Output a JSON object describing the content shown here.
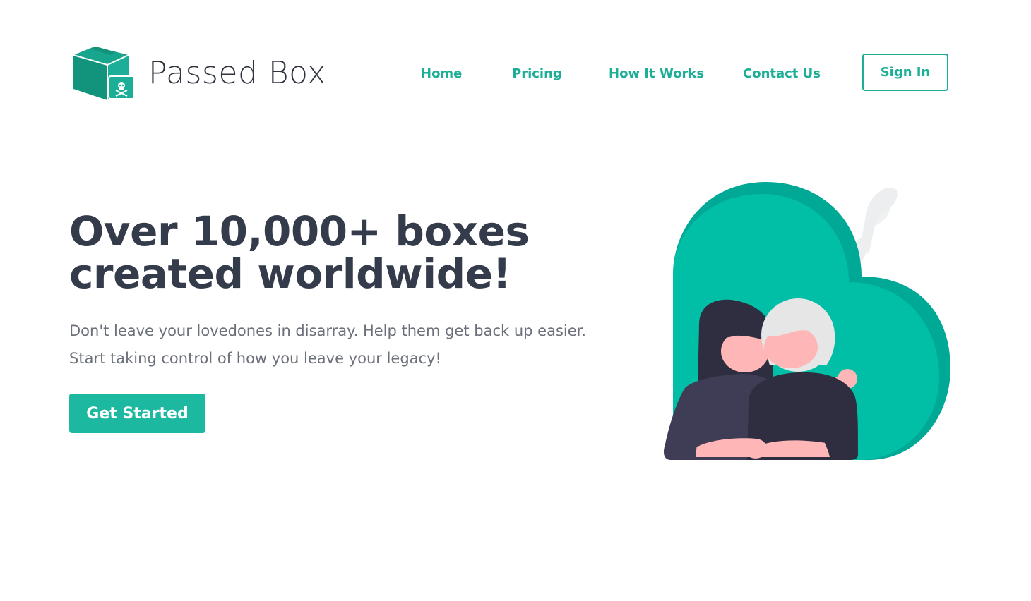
{
  "brand": {
    "name": "Passed Box",
    "logo_icon": "locked-box-icon"
  },
  "nav": {
    "items": [
      {
        "label": "Home"
      },
      {
        "label": "Pricing"
      },
      {
        "label": "How It Works"
      },
      {
        "label": "Contact Us"
      }
    ],
    "sign_in_label": "Sign In"
  },
  "hero": {
    "title": "Over 10,000+ boxes created worldwide!",
    "subtitle_line1": "Don't leave your lovedones in disarray. Help them get back up easier.",
    "subtitle_line2": "Start taking control of how you leave your legacy!",
    "cta_label": "Get Started",
    "illustration_icon": "couple-heart-illustration"
  },
  "colors": {
    "accent": "#1db8a0",
    "heart": "#00bfa6",
    "heading": "#343b4b",
    "body_text": "#6b707a"
  }
}
